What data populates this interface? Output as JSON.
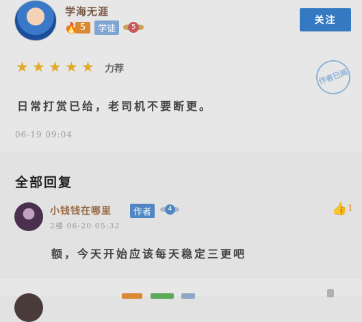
{
  "post": {
    "username": "学海无涯",
    "fire_level": "5",
    "role_badge": "学徒",
    "rank_level": "5",
    "follow_label": "关注",
    "rating": 5,
    "rating_label": "力荐",
    "stamp_text": "作者已阅",
    "comment": "日常打赏已给，老司机不要断更。",
    "timestamp": "06-19 09:04"
  },
  "replies_section": {
    "title": "全部回复"
  },
  "reply": {
    "username": "小钱钱在哪里",
    "author_badge": "作者",
    "level": "4",
    "meta": "2楼 06-20 05:32",
    "like_count": "1",
    "text": "额，今天开始应该每天稳定三更吧"
  },
  "colors": {
    "accent": "#3479c2",
    "fire": "#d98931",
    "star": "#e1a92a"
  }
}
